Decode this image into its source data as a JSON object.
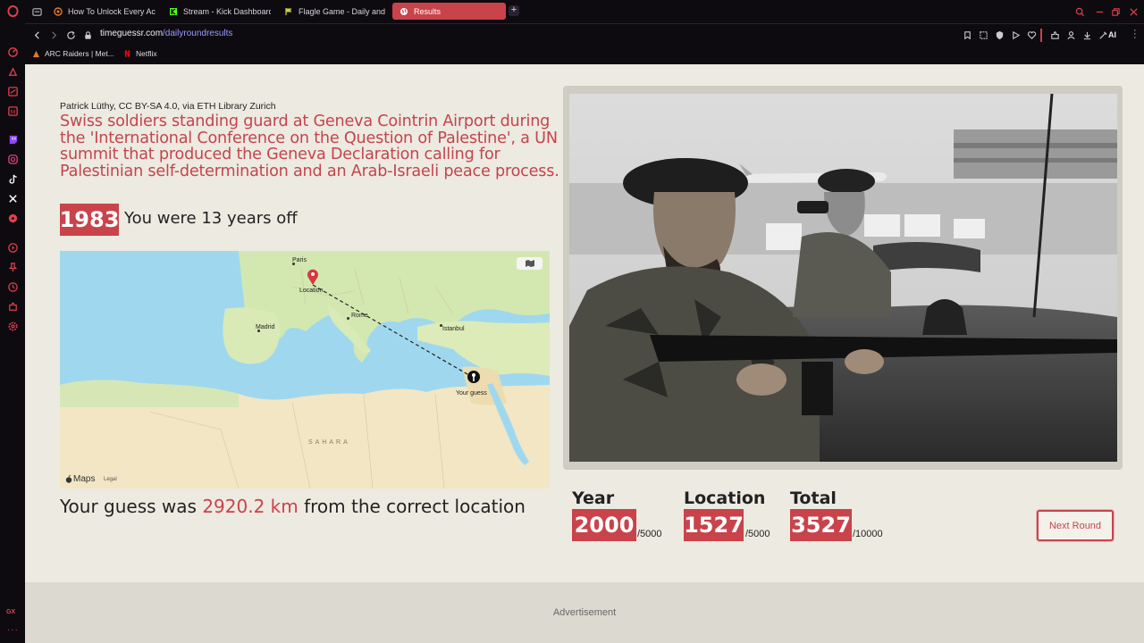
{
  "browser": {
    "tabs": [
      {
        "label": "How To Unlock Every Ach"
      },
      {
        "label": "Stream - Kick Dashboard"
      },
      {
        "label": "Flagle Game - Daily and U"
      },
      {
        "label": "Results"
      }
    ],
    "url_host": "timeguessr.com",
    "url_path": "/dailyroundresults",
    "ai_label": "AI",
    "bookmarks": [
      {
        "label": "ARC Raiders | Met..."
      },
      {
        "label": "Netflix"
      }
    ],
    "sidebar_badge": "GX"
  },
  "result": {
    "credit": "Patrick Lüthy, CC BY-SA 4.0, via ETH Library Zurich",
    "caption": "Swiss soldiers standing guard at Geneva Cointrin Airport during the 'International Conference on the Question of Palestine', a UN summit that produced the Geneva Declaration calling for Palestinian self-determination and an Arab-Israeli peace process.",
    "year": "1983",
    "years_off": "You were 13 years off",
    "distance_prefix": "Your guess was ",
    "distance_value": "2920.2 km",
    "distance_suffix": " from the correct location"
  },
  "map": {
    "labels": {
      "paris": "Paris",
      "location": "Location",
      "rome": "Rome",
      "madrid": "Madrid",
      "istanbul": "Istanbul",
      "your_guess": "Your guess",
      "sahara": "SAHARA"
    },
    "brand": "Maps",
    "legal": "Legal"
  },
  "scores": {
    "year": {
      "label": "Year",
      "value": "2000",
      "max": "/5000"
    },
    "location": {
      "label": "Location",
      "value": "1527",
      "max": "/5000"
    },
    "total": {
      "label": "Total",
      "value": "3527",
      "max": "/10000"
    }
  },
  "next_button": "Next Round",
  "advertisement": "Advertisement",
  "colors": {
    "accent": "#c9434b",
    "page_bg": "#edeae1",
    "browser_bg": "#0d0b10"
  }
}
